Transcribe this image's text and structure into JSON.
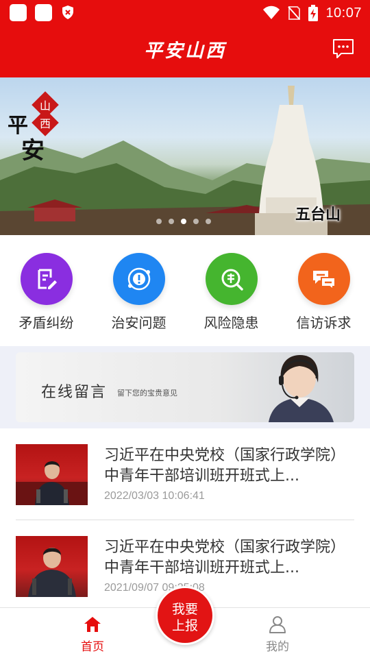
{
  "status_bar": {
    "time": "10:07",
    "icons": [
      "notification-square-icon",
      "notification-square-icon",
      "shield-x-icon",
      "wifi-icon",
      "no-signal-icon",
      "battery-charging-icon"
    ]
  },
  "header": {
    "title": "平安山西",
    "action_icon": "message-icon"
  },
  "banner": {
    "caption": "五台山",
    "logo_text": [
      "山",
      "西",
      "平",
      "安"
    ],
    "slide_count": 5,
    "active_slide": 3
  },
  "quick_grid": [
    {
      "label": "矛盾纠纷",
      "icon": "edit-document-icon",
      "color": "#8a2ee0"
    },
    {
      "label": "治安问题",
      "icon": "alert-orbit-icon",
      "color": "#1f86f2"
    },
    {
      "label": "风险隐患",
      "icon": "risk-search-icon",
      "color": "#45b52f"
    },
    {
      "label": "信访诉求",
      "icon": "chat-bubbles-icon",
      "color": "#f2641c"
    }
  ],
  "online_message": {
    "title": "在线留言",
    "subtitle": "留下您的宝贵意见"
  },
  "news": [
    {
      "title": "习近平在中央党校（国家行政学院）中青年干部培训班开班式上...",
      "date": "2022/03/03 10:06:41"
    },
    {
      "title": "习近平在中央党校（国家行政学院）中青年干部培训班开班式上...",
      "date": "2021/09/07 09:25:08"
    }
  ],
  "bottom_nav": {
    "home_label": "首页",
    "mine_label": "我的",
    "report_label_line1": "我要",
    "report_label_line2": "上报"
  },
  "colors": {
    "brand_red": "#e60d0d",
    "active_nav": "#e60d0d",
    "inactive_nav": "#888888"
  }
}
